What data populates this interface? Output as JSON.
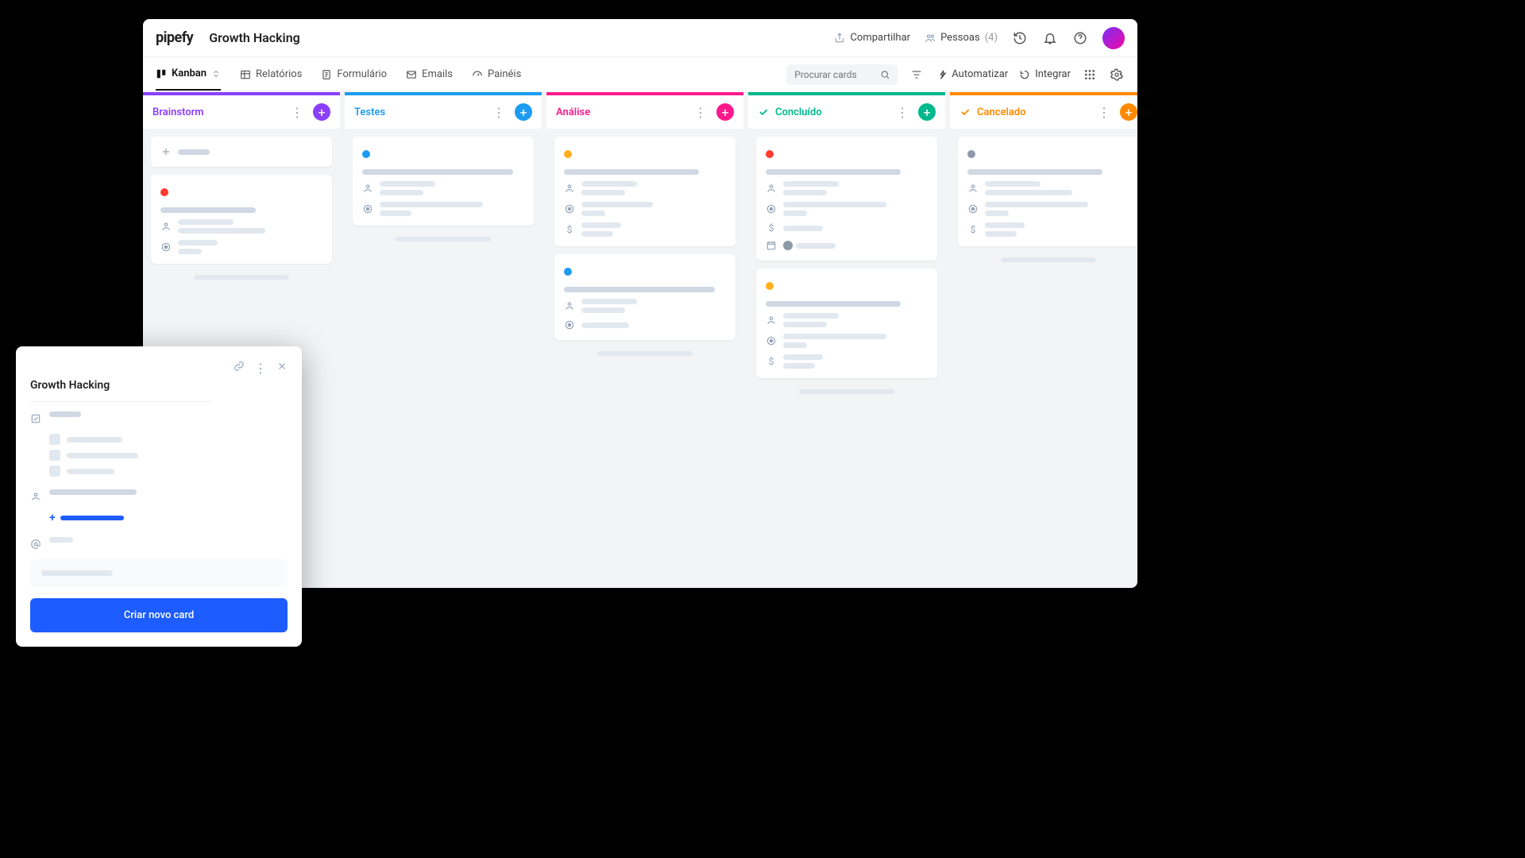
{
  "header": {
    "logo": "pipefy",
    "pipe_title": "Growth Hacking",
    "share_label": "Compartilhar",
    "people_label": "Pessoas",
    "people_count": "(4)"
  },
  "toolbar": {
    "tabs": {
      "kanban": "Kanban",
      "reports": "Relatórios",
      "form": "Formulário",
      "emails": "Emails",
      "dashboards": "Painéis"
    },
    "search_placeholder": "Procurar cards",
    "automate": "Automatizar",
    "integrate": "Integrar"
  },
  "phases": [
    {
      "name": "Brainstorm",
      "color": "#8a3ffc",
      "add_color": "#8a3ffc",
      "done": false
    },
    {
      "name": "Testes",
      "color": "#1d9bf0",
      "add_color": "#1d9bf0",
      "done": false
    },
    {
      "name": "Análise",
      "color": "#ff1a8c",
      "add_color": "#ff1a8c",
      "done": false
    },
    {
      "name": "Concluído",
      "color": "#00b88d",
      "add_color": "#00b88d",
      "done": true
    },
    {
      "name": "Cancelado",
      "color": "#ff8a00",
      "add_color": "#ff8a00",
      "done": true
    }
  ],
  "colors": {
    "red": "#ff3b30",
    "blue": "#1d9bf0",
    "amber": "#ffb020",
    "gray": "#8e99a8"
  },
  "modal": {
    "title": "Growth Hacking",
    "create_button": "Criar novo card"
  }
}
